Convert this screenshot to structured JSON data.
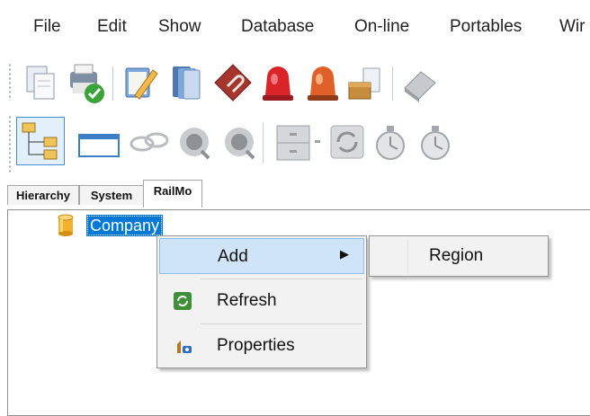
{
  "menu": {
    "items": [
      {
        "label": "File"
      },
      {
        "label": "Edit"
      },
      {
        "label": "Show"
      },
      {
        "label": "Database"
      },
      {
        "label": "On-line"
      },
      {
        "label": "Portables"
      },
      {
        "label": "Wir"
      }
    ]
  },
  "tabs": [
    {
      "label": "Hierarchy"
    },
    {
      "label": "System"
    },
    {
      "label": "RailMo",
      "active": true
    }
  ],
  "tree": {
    "root": {
      "label": "Company",
      "icon": "database-cylinder-icon",
      "selected": true
    }
  },
  "context_menu": {
    "items": [
      {
        "label": "Add",
        "submenu": true,
        "highlighted": true
      },
      {
        "label": "Refresh",
        "icon": "refresh-icon"
      },
      {
        "label": "Properties",
        "icon": "properties-icon"
      }
    ],
    "submenu": [
      {
        "label": "Region"
      }
    ]
  },
  "colors": {
    "selection": "#0078d7",
    "menu_highlight": "#cfe4f7",
    "menu_bg": "#f2f2f2"
  }
}
